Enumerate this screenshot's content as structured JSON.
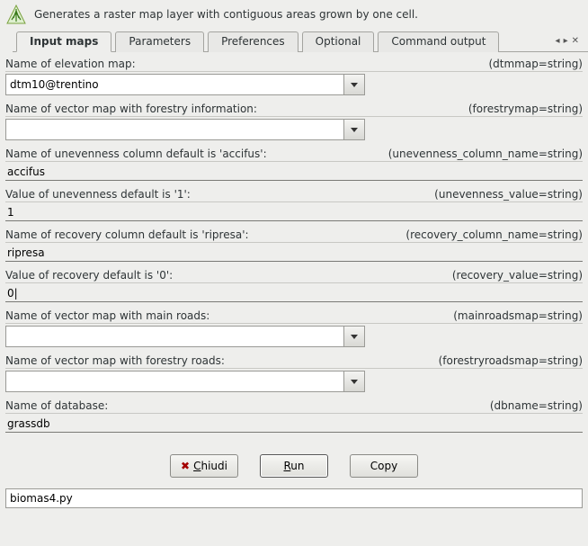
{
  "header": {
    "description": "Generates a raster map layer with contiguous areas grown by one cell."
  },
  "tabs": [
    {
      "label": "Input maps",
      "active": true
    },
    {
      "label": "Parameters",
      "active": false
    },
    {
      "label": "Preferences",
      "active": false
    },
    {
      "label": "Optional",
      "active": false
    },
    {
      "label": "Command output",
      "active": false
    }
  ],
  "fields": {
    "elevation": {
      "label": "Name of elevation map:",
      "param": "(dtmmap=string)",
      "value": "dtm10@trentino",
      "type": "combo"
    },
    "forestry": {
      "label": "Name of vector map with forestry information:",
      "param": "(forestrymap=string)",
      "value": "",
      "type": "combo"
    },
    "unevenness_col": {
      "label": "Name of unevenness column default is 'accifus':",
      "param": "(unevenness_column_name=string)",
      "value": "accifus",
      "type": "text"
    },
    "unevenness_val": {
      "label": "Value of unevenness default is '1':",
      "param": "(unevenness_value=string)",
      "value": "1",
      "type": "text"
    },
    "recovery_col": {
      "label": "Name of recovery column default is 'ripresa':",
      "param": "(recovery_column_name=string)",
      "value": "ripresa",
      "type": "text"
    },
    "recovery_val": {
      "label": "Value of recovery default is '0':",
      "param": "(recovery_value=string)",
      "value": "0|",
      "type": "text"
    },
    "mainroads": {
      "label": "Name of vector map with main roads:",
      "param": "(mainroadsmap=string)",
      "value": "",
      "type": "combo"
    },
    "forestryroads": {
      "label": "Name of vector map with forestry roads:",
      "param": "(forestryroadsmap=string)",
      "value": "",
      "type": "combo"
    },
    "dbname": {
      "label": "Name of database:",
      "param": "(dbname=string)",
      "value": "grassdb",
      "type": "text"
    }
  },
  "buttons": {
    "close": "Chiudi",
    "run": "Run",
    "copy": "Copy"
  },
  "footer": {
    "command": "biomas4.py"
  },
  "tab_controls": {
    "prev": "◂",
    "next": "▸",
    "close": "✕"
  }
}
